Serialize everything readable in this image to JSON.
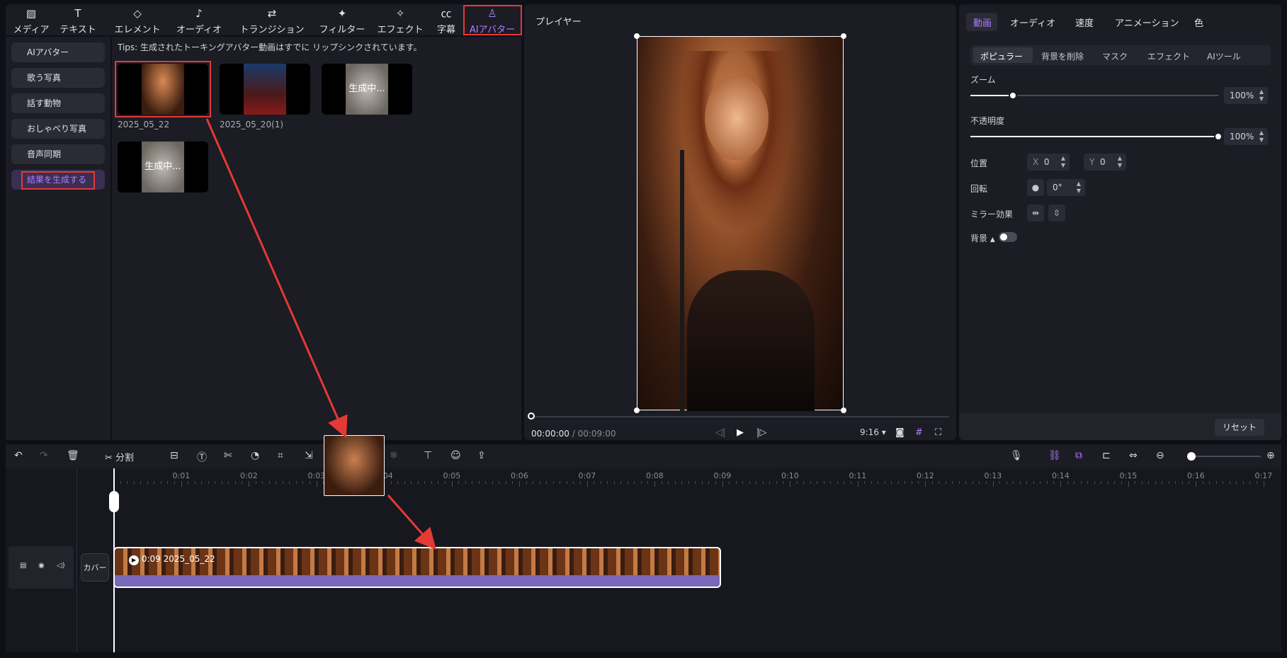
{
  "top_tabs": [
    {
      "label": "メディア",
      "icon": "media-icon"
    },
    {
      "label": "テキスト",
      "icon": "text-icon"
    },
    {
      "label": "エレメント",
      "icon": "element-icon"
    },
    {
      "label": "オーディオ",
      "icon": "audio-icon"
    },
    {
      "label": "トランジション",
      "icon": "transition-icon"
    },
    {
      "label": "フィルター",
      "icon": "filter-icon"
    },
    {
      "label": "エフェクト",
      "icon": "effect-icon"
    },
    {
      "label": "字幕",
      "icon": "caption-icon"
    },
    {
      "label": "AIアバター",
      "icon": "ai-avatar-icon"
    }
  ],
  "sidebar": {
    "items": [
      "AIアバター",
      "歌う写真",
      "話す動物",
      "おしゃべり写真",
      "音声同期",
      "結果を生成する"
    ]
  },
  "media": {
    "tips": "Tips:  生成されたトーキングアバター動画はすでに リップシンクされています。",
    "thumbs": [
      {
        "label": "2025_05_22"
      },
      {
        "label": "2025_05_20(1)"
      },
      {
        "label": "",
        "status": "生成中..."
      },
      {
        "label": "",
        "status": "生成中..."
      }
    ]
  },
  "player": {
    "title": "プレイヤー",
    "current_time": "00:00:00",
    "separator": " / ",
    "total_time": "00:09:00",
    "aspect": "9:16"
  },
  "props": {
    "tabs": [
      "動画",
      "オーディオ",
      "速度",
      "アニメーション",
      "色"
    ],
    "sub_tabs": [
      "ポピュラー",
      "背景を削除",
      "マスク",
      "エフェクト",
      "AIツール"
    ],
    "zoom_label": "ズーム",
    "zoom_value": "100%",
    "zoom_fraction": 0.17,
    "opacity_label": "不透明度",
    "opacity_value": "100%",
    "opacity_fraction": 1.0,
    "position_label": "位置",
    "x_label": "X",
    "x_value": "0",
    "y_label": "Y",
    "y_value": "0",
    "rotation_label": "回転",
    "rotation_value": "0°",
    "mirror_label": "ミラー効果",
    "background_label": "背景",
    "reset_label": "リセット"
  },
  "timeline": {
    "split_label": "分割",
    "ruler": [
      "0:01",
      "0:02",
      "0:03",
      "0:04",
      "0:05",
      "0:06",
      "0:07",
      "0:08",
      "0:09",
      "0:10",
      "0:11",
      "0:12",
      "0:13",
      "0:14",
      "0:15",
      "0:16",
      "0:17"
    ],
    "cover_label": "カバー",
    "clip_label": "0:09 2025_05_22"
  },
  "colors": {
    "accent": "#b07cff",
    "highlight": "#e53935"
  }
}
